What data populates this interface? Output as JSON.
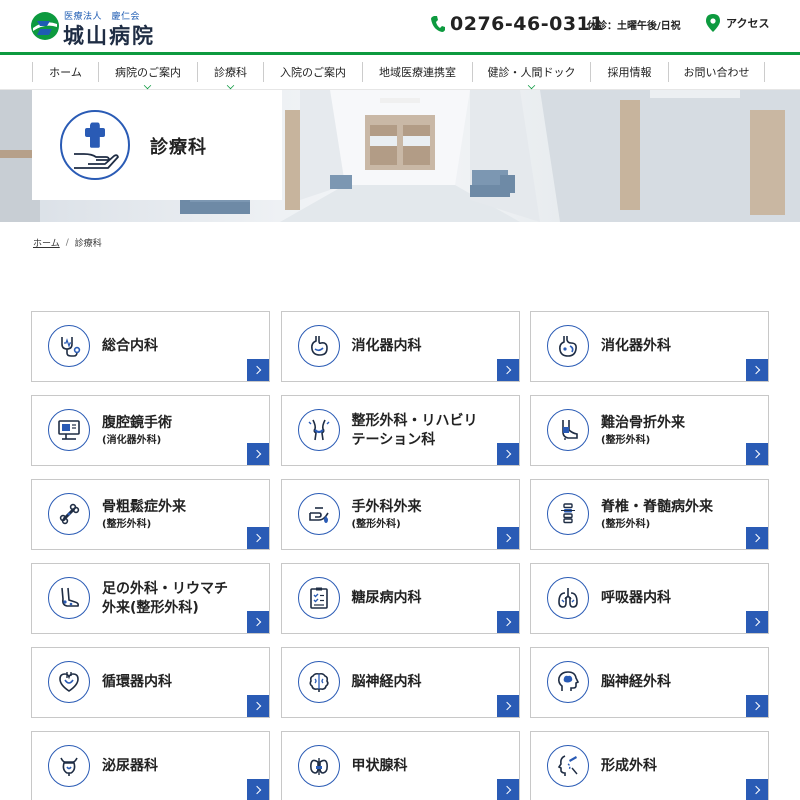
{
  "header": {
    "logo_sub": "医療法人　慶仁会",
    "logo_main": "城山病院",
    "phone": "0276-46-0311",
    "holiday": "休診：土曜午後/日祝",
    "access": "アクセス",
    "colors": {
      "brand_green": "#0d9a3f",
      "brand_blue": "#2a5bb5"
    }
  },
  "nav": {
    "items": [
      {
        "label": "ホーム",
        "dropdown": false
      },
      {
        "label": "病院のご案内",
        "dropdown": true
      },
      {
        "label": "診療科",
        "dropdown": true
      },
      {
        "label": "入院のご案内",
        "dropdown": false
      },
      {
        "label": "地域医療連携室",
        "dropdown": false
      },
      {
        "label": "健診・人間ドック",
        "dropdown": true
      },
      {
        "label": "採用情報",
        "dropdown": false
      },
      {
        "label": "お問い合わせ",
        "dropdown": false
      }
    ]
  },
  "hero": {
    "title": "診療科",
    "icon": "hand-medical-cross-icon"
  },
  "breadcrumb": {
    "home": "ホーム",
    "separator": "/",
    "current": "診療科"
  },
  "departments": [
    {
      "title": "総合内科",
      "sub": "",
      "icon": "stethoscope-icon"
    },
    {
      "title": "消化器内科",
      "sub": "",
      "icon": "stomach-icon"
    },
    {
      "title": "消化器外科",
      "sub": "",
      "icon": "stomach-organ-icon"
    },
    {
      "title": "腹腔鏡手術",
      "sub": "(消化器外科)",
      "icon": "laparoscope-monitor-icon"
    },
    {
      "title": "整形外科・リハビリ",
      "sub": "テーション科",
      "icon": "knee-joint-icon"
    },
    {
      "title": "難治骨折外来",
      "sub": "(整形外科)",
      "icon": "foot-cast-icon"
    },
    {
      "title": "骨粗鬆症外来",
      "sub": "(整形外科)",
      "icon": "bone-icon"
    },
    {
      "title": "手外科外来",
      "sub": "(整形外科)",
      "icon": "hand-icon"
    },
    {
      "title": "脊椎・脊髄病外来",
      "sub": "(整形外科)",
      "icon": "spine-icon"
    },
    {
      "title": "足の外科・リウマチ",
      "sub": "外来(整形外科)",
      "icon": "foot-icon"
    },
    {
      "title": "糖尿病内科",
      "sub": "",
      "icon": "clipboard-checklist-icon"
    },
    {
      "title": "呼吸器内科",
      "sub": "",
      "icon": "lungs-icon"
    },
    {
      "title": "循環器内科",
      "sub": "",
      "icon": "heart-icon"
    },
    {
      "title": "脳神経内科",
      "sub": "",
      "icon": "brain-icon"
    },
    {
      "title": "脳神経外科",
      "sub": "",
      "icon": "head-brain-icon"
    },
    {
      "title": "泌尿器科",
      "sub": "",
      "icon": "bladder-icon"
    },
    {
      "title": "甲状腺科",
      "sub": "",
      "icon": "thyroid-icon"
    },
    {
      "title": "形成外科",
      "sub": "",
      "icon": "face-surgery-icon"
    }
  ]
}
